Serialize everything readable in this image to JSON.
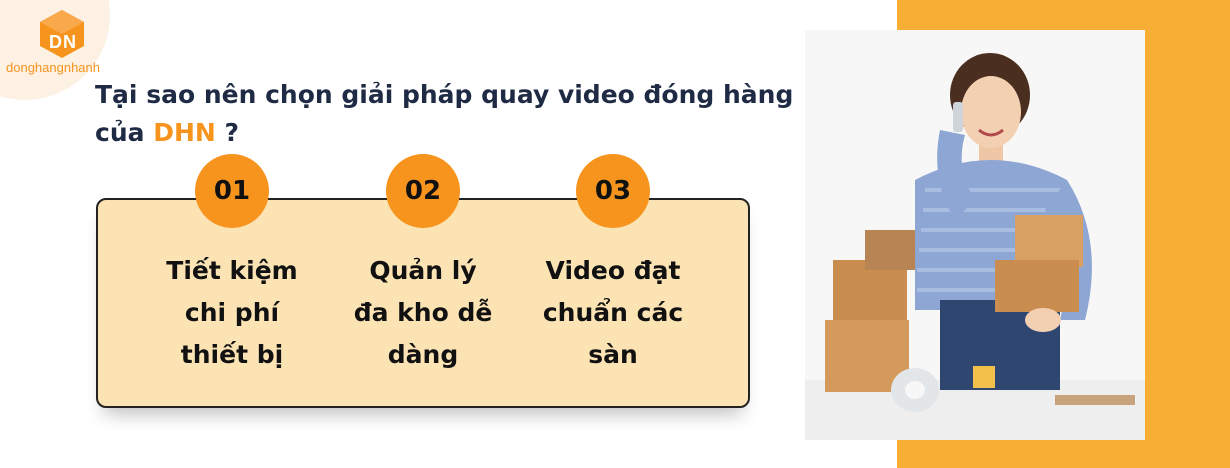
{
  "brand": {
    "logo_text": "donghangnhanh",
    "logo_icon": "dn-cube-logo-icon",
    "accent_color": "#f7941d",
    "secondary_color": "#f7ae34"
  },
  "headline": {
    "line1": "Tại sao nên chọn giải pháp quay video đóng hàng",
    "line2_prefix": "của",
    "brand": "DHN",
    "suffix": "?"
  },
  "features": [
    {
      "number": "01",
      "line1": "Tiết kiệm",
      "line2": "chi phí",
      "line3": "thiết bị"
    },
    {
      "number": "02",
      "line1": "Quản lý",
      "line2": "đa kho dễ",
      "line3": "dàng"
    },
    {
      "number": "03",
      "line1": "Video đạt",
      "line2": "chuẩn các",
      "line3": "sàn"
    }
  ],
  "photo": {
    "subject": "woman-holding-parcels-on-phone"
  }
}
